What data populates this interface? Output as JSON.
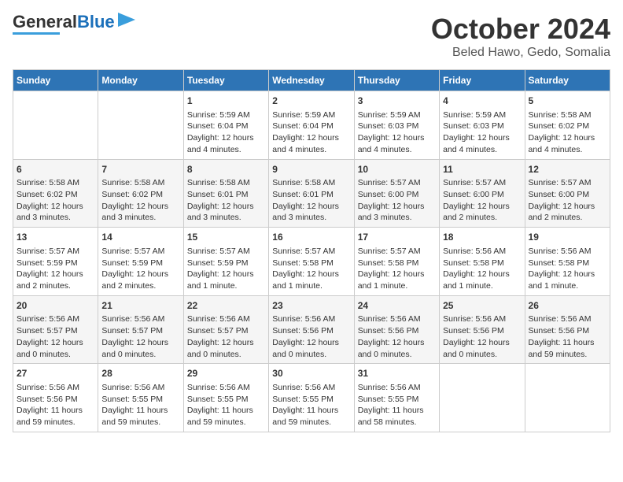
{
  "header": {
    "logo_general": "General",
    "logo_blue": "Blue",
    "month_title": "October 2024",
    "location": "Beled Hawo, Gedo, Somalia"
  },
  "days_of_week": [
    "Sunday",
    "Monday",
    "Tuesday",
    "Wednesday",
    "Thursday",
    "Friday",
    "Saturday"
  ],
  "weeks": [
    [
      {
        "day": "",
        "sunrise": "",
        "sunset": "",
        "daylight": ""
      },
      {
        "day": "",
        "sunrise": "",
        "sunset": "",
        "daylight": ""
      },
      {
        "day": "1",
        "sunrise": "Sunrise: 5:59 AM",
        "sunset": "Sunset: 6:04 PM",
        "daylight": "Daylight: 12 hours and 4 minutes."
      },
      {
        "day": "2",
        "sunrise": "Sunrise: 5:59 AM",
        "sunset": "Sunset: 6:04 PM",
        "daylight": "Daylight: 12 hours and 4 minutes."
      },
      {
        "day": "3",
        "sunrise": "Sunrise: 5:59 AM",
        "sunset": "Sunset: 6:03 PM",
        "daylight": "Daylight: 12 hours and 4 minutes."
      },
      {
        "day": "4",
        "sunrise": "Sunrise: 5:59 AM",
        "sunset": "Sunset: 6:03 PM",
        "daylight": "Daylight: 12 hours and 4 minutes."
      },
      {
        "day": "5",
        "sunrise": "Sunrise: 5:58 AM",
        "sunset": "Sunset: 6:02 PM",
        "daylight": "Daylight: 12 hours and 4 minutes."
      }
    ],
    [
      {
        "day": "6",
        "sunrise": "Sunrise: 5:58 AM",
        "sunset": "Sunset: 6:02 PM",
        "daylight": "Daylight: 12 hours and 3 minutes."
      },
      {
        "day": "7",
        "sunrise": "Sunrise: 5:58 AM",
        "sunset": "Sunset: 6:02 PM",
        "daylight": "Daylight: 12 hours and 3 minutes."
      },
      {
        "day": "8",
        "sunrise": "Sunrise: 5:58 AM",
        "sunset": "Sunset: 6:01 PM",
        "daylight": "Daylight: 12 hours and 3 minutes."
      },
      {
        "day": "9",
        "sunrise": "Sunrise: 5:58 AM",
        "sunset": "Sunset: 6:01 PM",
        "daylight": "Daylight: 12 hours and 3 minutes."
      },
      {
        "day": "10",
        "sunrise": "Sunrise: 5:57 AM",
        "sunset": "Sunset: 6:00 PM",
        "daylight": "Daylight: 12 hours and 3 minutes."
      },
      {
        "day": "11",
        "sunrise": "Sunrise: 5:57 AM",
        "sunset": "Sunset: 6:00 PM",
        "daylight": "Daylight: 12 hours and 2 minutes."
      },
      {
        "day": "12",
        "sunrise": "Sunrise: 5:57 AM",
        "sunset": "Sunset: 6:00 PM",
        "daylight": "Daylight: 12 hours and 2 minutes."
      }
    ],
    [
      {
        "day": "13",
        "sunrise": "Sunrise: 5:57 AM",
        "sunset": "Sunset: 5:59 PM",
        "daylight": "Daylight: 12 hours and 2 minutes."
      },
      {
        "day": "14",
        "sunrise": "Sunrise: 5:57 AM",
        "sunset": "Sunset: 5:59 PM",
        "daylight": "Daylight: 12 hours and 2 minutes."
      },
      {
        "day": "15",
        "sunrise": "Sunrise: 5:57 AM",
        "sunset": "Sunset: 5:59 PM",
        "daylight": "Daylight: 12 hours and 1 minute."
      },
      {
        "day": "16",
        "sunrise": "Sunrise: 5:57 AM",
        "sunset": "Sunset: 5:58 PM",
        "daylight": "Daylight: 12 hours and 1 minute."
      },
      {
        "day": "17",
        "sunrise": "Sunrise: 5:57 AM",
        "sunset": "Sunset: 5:58 PM",
        "daylight": "Daylight: 12 hours and 1 minute."
      },
      {
        "day": "18",
        "sunrise": "Sunrise: 5:56 AM",
        "sunset": "Sunset: 5:58 PM",
        "daylight": "Daylight: 12 hours and 1 minute."
      },
      {
        "day": "19",
        "sunrise": "Sunrise: 5:56 AM",
        "sunset": "Sunset: 5:58 PM",
        "daylight": "Daylight: 12 hours and 1 minute."
      }
    ],
    [
      {
        "day": "20",
        "sunrise": "Sunrise: 5:56 AM",
        "sunset": "Sunset: 5:57 PM",
        "daylight": "Daylight: 12 hours and 0 minutes."
      },
      {
        "day": "21",
        "sunrise": "Sunrise: 5:56 AM",
        "sunset": "Sunset: 5:57 PM",
        "daylight": "Daylight: 12 hours and 0 minutes."
      },
      {
        "day": "22",
        "sunrise": "Sunrise: 5:56 AM",
        "sunset": "Sunset: 5:57 PM",
        "daylight": "Daylight: 12 hours and 0 minutes."
      },
      {
        "day": "23",
        "sunrise": "Sunrise: 5:56 AM",
        "sunset": "Sunset: 5:56 PM",
        "daylight": "Daylight: 12 hours and 0 minutes."
      },
      {
        "day": "24",
        "sunrise": "Sunrise: 5:56 AM",
        "sunset": "Sunset: 5:56 PM",
        "daylight": "Daylight: 12 hours and 0 minutes."
      },
      {
        "day": "25",
        "sunrise": "Sunrise: 5:56 AM",
        "sunset": "Sunset: 5:56 PM",
        "daylight": "Daylight: 12 hours and 0 minutes."
      },
      {
        "day": "26",
        "sunrise": "Sunrise: 5:56 AM",
        "sunset": "Sunset: 5:56 PM",
        "daylight": "Daylight: 11 hours and 59 minutes."
      }
    ],
    [
      {
        "day": "27",
        "sunrise": "Sunrise: 5:56 AM",
        "sunset": "Sunset: 5:56 PM",
        "daylight": "Daylight: 11 hours and 59 minutes."
      },
      {
        "day": "28",
        "sunrise": "Sunrise: 5:56 AM",
        "sunset": "Sunset: 5:55 PM",
        "daylight": "Daylight: 11 hours and 59 minutes."
      },
      {
        "day": "29",
        "sunrise": "Sunrise: 5:56 AM",
        "sunset": "Sunset: 5:55 PM",
        "daylight": "Daylight: 11 hours and 59 minutes."
      },
      {
        "day": "30",
        "sunrise": "Sunrise: 5:56 AM",
        "sunset": "Sunset: 5:55 PM",
        "daylight": "Daylight: 11 hours and 59 minutes."
      },
      {
        "day": "31",
        "sunrise": "Sunrise: 5:56 AM",
        "sunset": "Sunset: 5:55 PM",
        "daylight": "Daylight: 11 hours and 58 minutes."
      },
      {
        "day": "",
        "sunrise": "",
        "sunset": "",
        "daylight": ""
      },
      {
        "day": "",
        "sunrise": "",
        "sunset": "",
        "daylight": ""
      }
    ]
  ]
}
